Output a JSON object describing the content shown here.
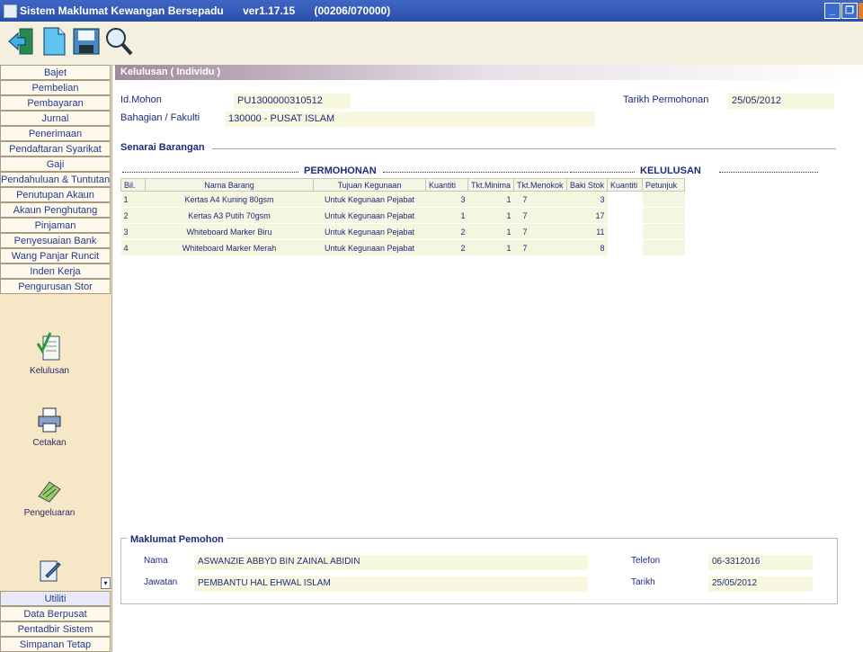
{
  "window": {
    "app_name": "Sistem Maklumat Kewangan Bersepadu",
    "version": "ver1.17.15",
    "code": "(00206/070000)"
  },
  "toolbar": {
    "icons": [
      "exit-icon",
      "new-document-icon",
      "save-icon",
      "search-icon"
    ]
  },
  "sidebar": {
    "menu": [
      "Bajet",
      "Pembelian",
      "Pembayaran",
      "Jurnal",
      "Penerimaan",
      "Pendaftaran Syarikat",
      "Gaji",
      "Pendahuluan & Tuntutan",
      "Penutupan Akaun",
      "Akaun Penghutang",
      "Pinjaman",
      "Penyesuaian Bank",
      "Wang Panjar Runcit",
      "Inden Kerja",
      "Pengurusan Stor"
    ],
    "tools": [
      "Kelulusan",
      "Cetakan",
      "Pengeluaran"
    ],
    "bottom_menu": [
      "Utiliti",
      "Data Berpusat",
      "Pentadbir Sistem",
      "Simpanan Tetap"
    ]
  },
  "form": {
    "title": "Kelulusan ( Individu )",
    "id_label": "Id.Mohon",
    "id_value": "PU1300000310512",
    "date_label": "Tarikh Permohonan",
    "date_value": "25/05/2012",
    "dept_label": "Bahagian / Fakulti",
    "dept_value": "130000 - PUSAT ISLAM",
    "list_title": "Senarai Barangan",
    "group_request": "PERMOHONAN",
    "group_approval": "KELULUSAN",
    "columns": [
      "Bil.",
      "Nama Barang",
      "Tujuan Kegunaan",
      "Kuantiti",
      "Tkt.Minima",
      "Tkt.Menokok",
      "Baki Stok",
      "Kuantiti",
      "Petunjuk"
    ],
    "rows": [
      [
        "1",
        "Kertas A4 Kuning 80gsm",
        "Untuk Kegunaan Pejabat",
        "3",
        "1",
        "7",
        "3",
        "",
        ""
      ],
      [
        "2",
        "Kertas A3 Putih 70gsm",
        "Untuk Kegunaan Pejabat",
        "1",
        "1",
        "7",
        "17",
        "",
        ""
      ],
      [
        "3",
        "Whiteboard Marker Biru",
        "Untuk Kegunaan Pejabat",
        "2",
        "1",
        "7",
        "11",
        "",
        ""
      ],
      [
        "4",
        "Whiteboard Marker Merah",
        "Untuk Kegunaan Pejabat",
        "2",
        "1",
        "7",
        "8",
        "",
        ""
      ]
    ],
    "applicant": {
      "title": "Maklumat Pemohon",
      "name_label": "Nama",
      "name_value": "ASWANZIE ABBYD BIN ZAINAL ABIDIN",
      "phone_label": "Telefon",
      "phone_value": "06-3312016",
      "position_label": "Jawatan",
      "position_value": "PEMBANTU HAL EHWAL ISLAM",
      "date_label": "Tarikh",
      "date_value": "25/05/2012"
    }
  }
}
